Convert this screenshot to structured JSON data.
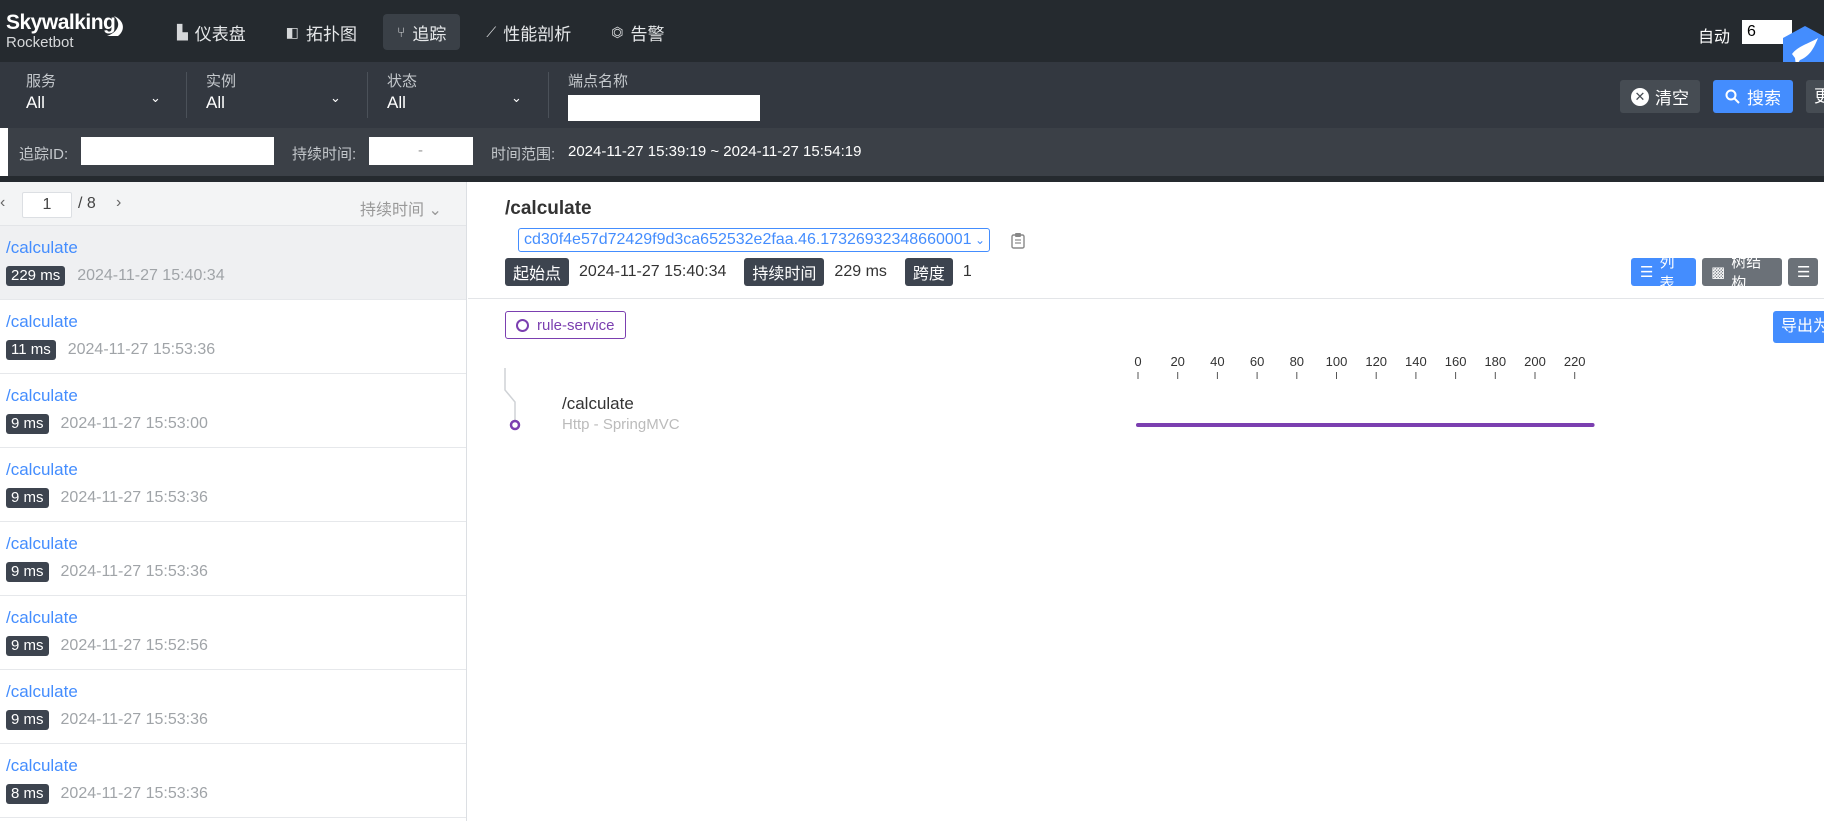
{
  "app": {
    "brand": "Skywalking",
    "subtitle": "Rocketbot"
  },
  "nav": [
    {
      "label": "仪表盘",
      "icon": "chart-bar-icon",
      "glyph": "▙"
    },
    {
      "label": "拓扑图",
      "icon": "topology-icon",
      "glyph": "◧"
    },
    {
      "label": "追踪",
      "icon": "trace-icon",
      "glyph": "⑂",
      "active": true
    },
    {
      "label": "性能剖析",
      "icon": "line-chart-icon",
      "glyph": "⟋"
    },
    {
      "label": "告警",
      "icon": "alarm-icon",
      "glyph": "⏣"
    }
  ],
  "auto": {
    "label": "自动",
    "value": "6"
  },
  "filters": {
    "service": {
      "label": "服务",
      "value": "All"
    },
    "instance": {
      "label": "实例",
      "value": "All"
    },
    "status": {
      "label": "状态",
      "value": "All"
    },
    "endpoint": {
      "label": "端点名称",
      "value": ""
    }
  },
  "buttons": {
    "clear": "清空",
    "search": "搜索",
    "more": "更"
  },
  "query": {
    "trace_id_label": "追踪ID:",
    "duration_label": "持续时间:",
    "duration_dash": "-",
    "time_range_label": "时间范围:",
    "time_range_value": "2024-11-27 15:39:19 ~ 2024-11-27 15:54:19"
  },
  "pager": {
    "current": "1",
    "total": "/ 8",
    "sort_label": "持续时间"
  },
  "traces": [
    {
      "name": "/calculate",
      "duration": "229 ms",
      "time": "2024-11-27 15:40:34",
      "selected": true
    },
    {
      "name": "/calculate",
      "duration": "11 ms",
      "time": "2024-11-27 15:53:36"
    },
    {
      "name": "/calculate",
      "duration": "9 ms",
      "time": "2024-11-27 15:53:00"
    },
    {
      "name": "/calculate",
      "duration": "9 ms",
      "time": "2024-11-27 15:53:36"
    },
    {
      "name": "/calculate",
      "duration": "9 ms",
      "time": "2024-11-27 15:53:36"
    },
    {
      "name": "/calculate",
      "duration": "9 ms",
      "time": "2024-11-27 15:52:56"
    },
    {
      "name": "/calculate",
      "duration": "9 ms",
      "time": "2024-11-27 15:53:36"
    },
    {
      "name": "/calculate",
      "duration": "8 ms",
      "time": "2024-11-27 15:53:36"
    }
  ],
  "detail": {
    "title": "/calculate",
    "trace_id": "cd30f4e57d72429f9d3ca652532e2faa.46.17326932348660001",
    "start_label": "起始点",
    "start_value": "2024-11-27 15:40:34",
    "duration_label": "持续时间",
    "duration_value": "229 ms",
    "span_label": "跨度",
    "span_value": "1",
    "view_list": "列表",
    "view_tree": "树结构",
    "service": "rule-service",
    "export": "导出为",
    "axis_ticks": [
      "0",
      "20",
      "40",
      "60",
      "80",
      "100",
      "120",
      "140",
      "160",
      "180",
      "200",
      "220"
    ],
    "span": {
      "name": "/calculate",
      "component": "Http - SpringMVC",
      "duration_ms": 229
    },
    "colors": {
      "accent": "#448dfe",
      "span": "#7b3fb0"
    }
  }
}
